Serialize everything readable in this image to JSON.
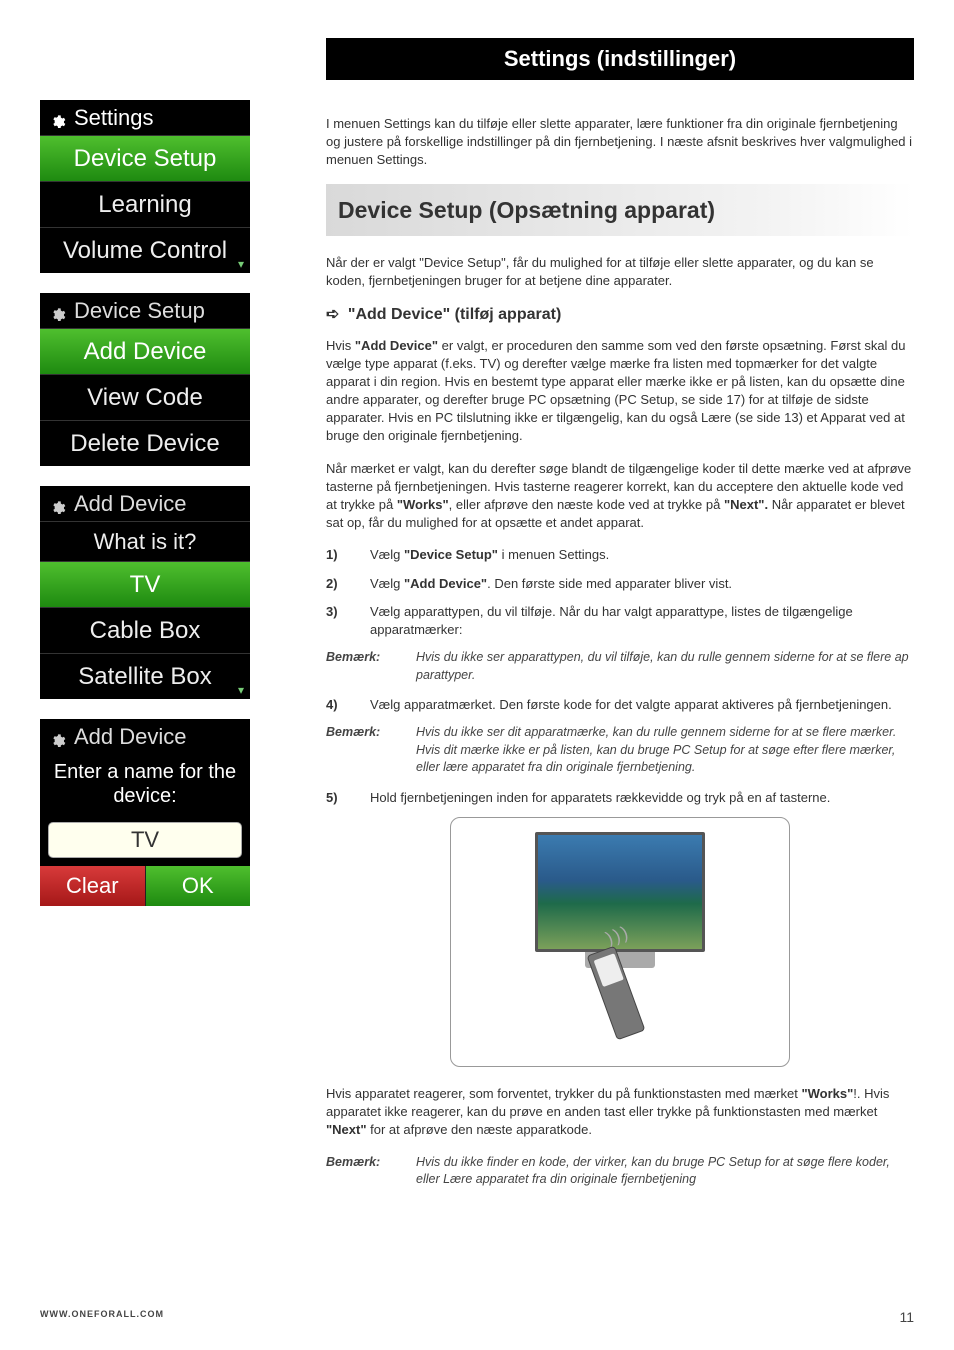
{
  "header": {
    "title": "Settings (indstillinger)"
  },
  "intro": "I menuen Settings kan du tilføje eller slette apparater, lære funktioner fra din originale fjernbetjening og justere på forskellige indstillinger på din fjernbetjening. I næste afsnit beskrives hver valgmulighed i menuen Settings.",
  "section": {
    "title": "Device Setup (Opsætning apparat)",
    "intro": "Når der er valgt \"Device Setup\", får du mulighed for at tilføje eller slette apparater, og du kan se koden, fjernbetjeningen bruger for at betjene dine apparater.",
    "sub_title": "\"Add Device\" (tilføj apparat)",
    "p1_pre": "Hvis ",
    "p1_bold": "\"Add Device\"",
    "p1_post": " er valgt, er proceduren den samme som ved den første opsætning. Først skal du vælge type apparat (f.eks. TV) og derefter vælge mærke fra listen med topmærker for det valgte apparat i din region. Hvis en bestemt type apparat eller mærke ikke er på listen, kan du opsætte dine andre apparater, og derefter bruge PC opsætning (PC Setup, se side 17) for at tilføje de sidste apparater. Hvis en PC tilslutning ikke er tilgængelig, kan du også Lære (se side 13) et Apparat ved at bruge den originale fjernbetjening.",
    "p2_a": "Når mærket er valgt, kan du derefter søge blandt de tilgængelige koder til dette mærke ved at afprøve tasterne på fjernbetjeningen. Hvis tasterne reagerer korrekt, kan du acceptere den aktuelle kode ved at trykke på ",
    "p2_b1": "\"Works\"",
    "p2_c": ", eller afprøve den næste kode ved at trykke på ",
    "p2_b2": "\"Next\".",
    "p2_d": " Når apparatet er blevet sat op, får du mulighed for at opsætte et andet apparat.",
    "steps": [
      {
        "n": "1)",
        "pre": "Vælg ",
        "bold": "\"Device Setup\"",
        "post": " i menuen Settings."
      },
      {
        "n": "2)",
        "pre": "Vælg ",
        "bold": "\"Add Device\"",
        "post": ". Den første side med apparater bliver vist."
      },
      {
        "n": "3)",
        "pre": "",
        "bold": "",
        "post": "Vælg apparattypen, du vil tilføje. Når du har valgt apparattype, listes de tilgængelige apparatmærker:"
      }
    ],
    "note1": {
      "label": "Bemærk:",
      "text": "Hvis du ikke ser apparattypen, du vil tilføje, kan du rulle gennem siderne for at se flere ap parattyper."
    },
    "step4": {
      "n": "4)",
      "text": "Vælg apparatmærket. Den første kode for det valgte apparat aktiveres på fjernbetjeningen."
    },
    "note2": {
      "label": "Bemærk:",
      "text": "Hvis du ikke ser dit apparatmærke, kan du rulle gennem siderne for at se flere mærker. Hvis dit mærke ikke er på listen, kan du bruge PC Setup for at søge efter flere mærker, eller lære apparatet fra din originale fjernbetjening."
    },
    "step5": {
      "n": "5)",
      "text": "Hold fjernbetjeningen inden for apparatets rækkevidde og tryk på en af tasterne."
    },
    "p3_a": "Hvis apparatet reagerer, som forventet, trykker du på funktionstasten med mærket ",
    "p3_b1": "\"Works\"",
    "p3_c": "!.\nHvis apparatet ikke reagerer, kan du prøve en anden tast eller trykke på funktionstasten med mærket ",
    "p3_b2": "\"Next\"",
    "p3_d": " for at afprøve den næste apparatkode.",
    "note3": {
      "label": "Bemærk:",
      "text": "Hvis du ikke finder en kode, der virker, kan du bruge PC Setup for at søge flere koder, eller Lære apparatet fra din originale fjernbetjening"
    }
  },
  "screens": {
    "s1": {
      "title": "Settings",
      "items": [
        "Device Setup",
        "Learning",
        "Volume Control"
      ]
    },
    "s2": {
      "title": "Device Setup",
      "items": [
        "Add Device",
        "View Code",
        "Delete Device"
      ]
    },
    "s3": {
      "title": "Add Device",
      "prompt": "What is it?",
      "items": [
        "TV",
        "Cable Box",
        "Satellite Box"
      ]
    },
    "s4": {
      "title": "Add Device",
      "prompt": "Enter a name for the device:",
      "value": "TV",
      "clear": "Clear",
      "ok": "OK"
    }
  },
  "footer": {
    "url": "WWW.ONEFORALL.COM",
    "page": "11"
  }
}
